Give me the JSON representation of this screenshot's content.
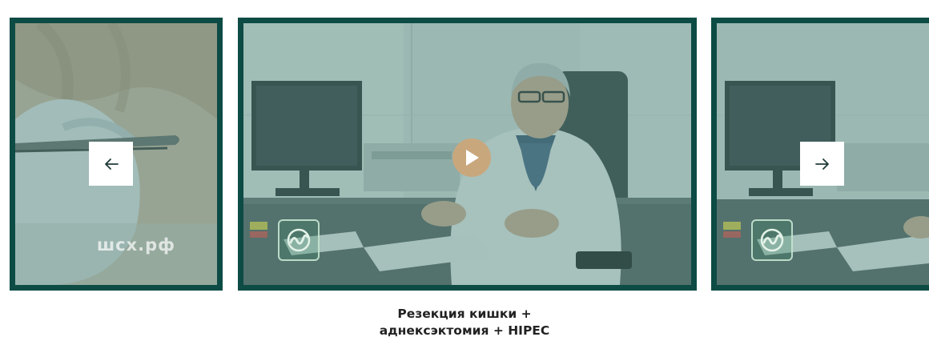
{
  "slides": {
    "left": {
      "watermark": "шсх.рф"
    },
    "center": {
      "play_icon": "play-icon",
      "logo_icon": "clinic-logo-icon"
    },
    "right": {
      "logo_icon": "clinic-logo-icon"
    }
  },
  "navigation": {
    "prev_icon": "arrow-left-icon",
    "next_icon": "arrow-right-icon"
  },
  "caption": {
    "line1": "Резекция кишки +",
    "line2": "аднексэктомия + HIPEC"
  },
  "colors": {
    "frame": "#0d4b45",
    "overlay": "#4a8076",
    "play_button": "#c9a77d",
    "caption_text": "#222222"
  }
}
